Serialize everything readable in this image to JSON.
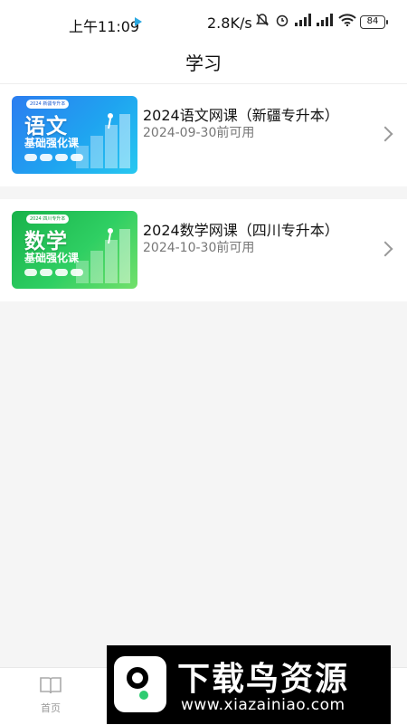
{
  "status_bar": {
    "time": "上午11:09",
    "speed": "2.8K/s",
    "battery": "84",
    "icons": [
      "play-icon",
      "mute-bell-icon",
      "alarm-icon",
      "signal-icon",
      "hd-signal-icon",
      "wifi-icon",
      "battery-icon"
    ]
  },
  "header": {
    "title": "学习"
  },
  "courses": [
    {
      "title": "2024语文网课（新疆专升本）",
      "expiry": "2024-09-30前可用",
      "thumb": {
        "banner": "2024 新疆专升本",
        "subject": "语文",
        "course": "基础强化课",
        "color": "#2c7df0"
      }
    },
    {
      "title": "2024数学网课（四川专升本）",
      "expiry": "2024-10-30前可用",
      "thumb": {
        "banner": "2024 四川专升本",
        "subject": "数学",
        "course": "基础强化课",
        "color": "#18b24a"
      }
    }
  ],
  "tabbar": {
    "home_label": "首页"
  },
  "watermark": {
    "title": "下载鸟资源",
    "url": "www.xiazainiao.com"
  }
}
